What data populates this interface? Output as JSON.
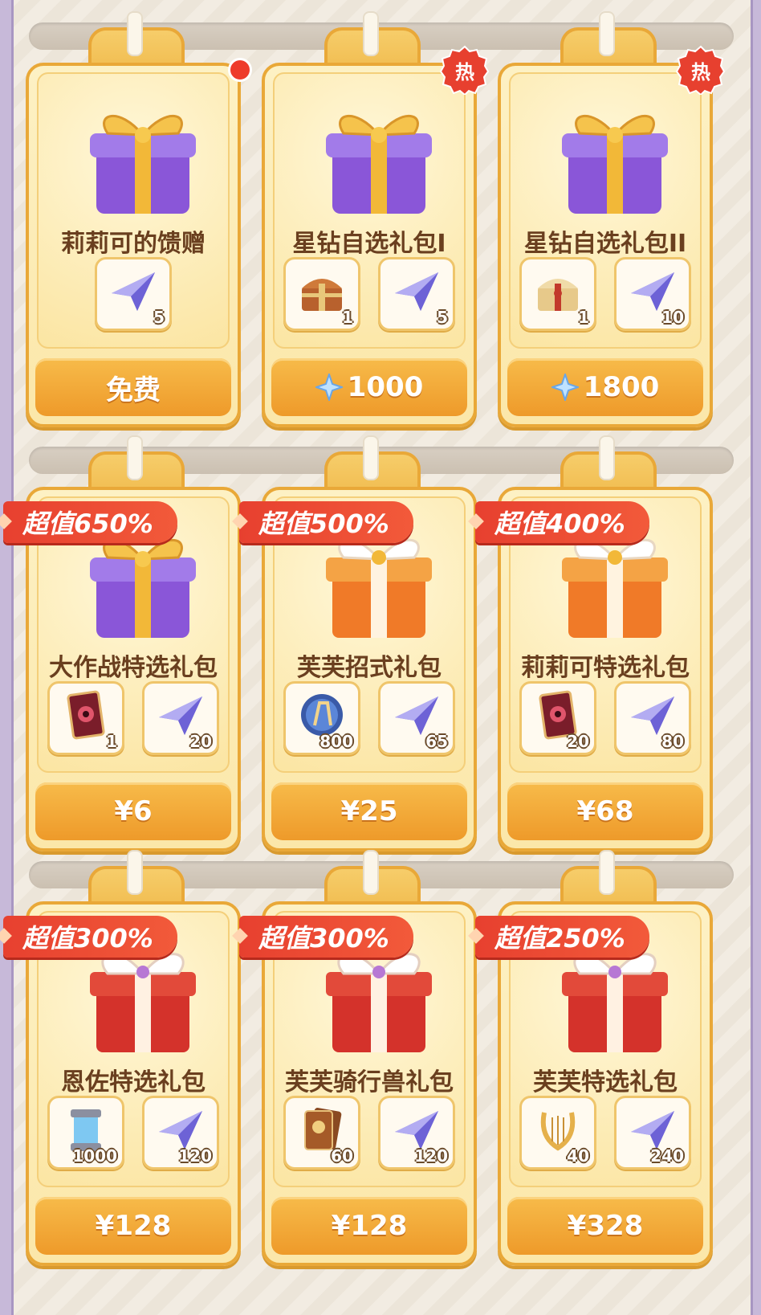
{
  "colors": {
    "accent": "#ee9a2a",
    "hot": "#e7402f",
    "text": "#6a3f1f"
  },
  "hot_label": "热",
  "cards": [
    {
      "name": "莉莉可的馈赠",
      "price": "免费",
      "badge": "dot",
      "gift": "purple",
      "items": [
        {
          "icon": "paper-plane-icon",
          "qty": "5"
        }
      ]
    },
    {
      "name": "星钻自选礼包I",
      "price": "1000",
      "currency": "star-diamond-icon",
      "badge": "hot",
      "gift": "purple",
      "items": [
        {
          "icon": "treasure-chest-icon",
          "qty": "1"
        },
        {
          "icon": "paper-plane-icon",
          "qty": "5"
        }
      ]
    },
    {
      "name": "星钻自选礼包II",
      "price": "1800",
      "currency": "star-diamond-icon",
      "badge": "hot",
      "gift": "purple",
      "items": [
        {
          "icon": "golden-chest-icon",
          "qty": "1"
        },
        {
          "icon": "paper-plane-icon",
          "qty": "10"
        }
      ]
    },
    {
      "name": "大作战特选礼包",
      "price": "¥6",
      "ribbon": "超值650%",
      "gift": "purple",
      "items": [
        {
          "icon": "eye-card-icon",
          "qty": "1"
        },
        {
          "icon": "paper-plane-icon",
          "qty": "20"
        }
      ]
    },
    {
      "name": "芙芙招式礼包",
      "price": "¥25",
      "ribbon": "超值500%",
      "gift": "orange",
      "items": [
        {
          "icon": "crystal-orb-icon",
          "qty": "800"
        },
        {
          "icon": "paper-plane-icon",
          "qty": "65"
        }
      ]
    },
    {
      "name": "莉莉可特选礼包",
      "price": "¥68",
      "ribbon": "超值400%",
      "gift": "orange",
      "items": [
        {
          "icon": "eye-card-icon",
          "qty": "20"
        },
        {
          "icon": "paper-plane-icon",
          "qty": "80"
        }
      ]
    },
    {
      "name": "恩佐特选礼包",
      "price": "¥128",
      "ribbon": "超值300%",
      "gift": "red",
      "items": [
        {
          "icon": "energy-canister-icon",
          "qty": "1000"
        },
        {
          "icon": "paper-plane-icon",
          "qty": "120"
        }
      ]
    },
    {
      "name": "芙芙骑行兽礼包",
      "price": "¥128",
      "ribbon": "超值300%",
      "gift": "red",
      "items": [
        {
          "icon": "ticket-book-icon",
          "qty": "60"
        },
        {
          "icon": "paper-plane-icon",
          "qty": "120"
        }
      ]
    },
    {
      "name": "芙芙特选礼包",
      "price": "¥328",
      "ribbon": "超值250%",
      "gift": "red",
      "items": [
        {
          "icon": "golden-lyre-icon",
          "qty": "40"
        },
        {
          "icon": "paper-plane-icon",
          "qty": "240"
        }
      ]
    }
  ]
}
